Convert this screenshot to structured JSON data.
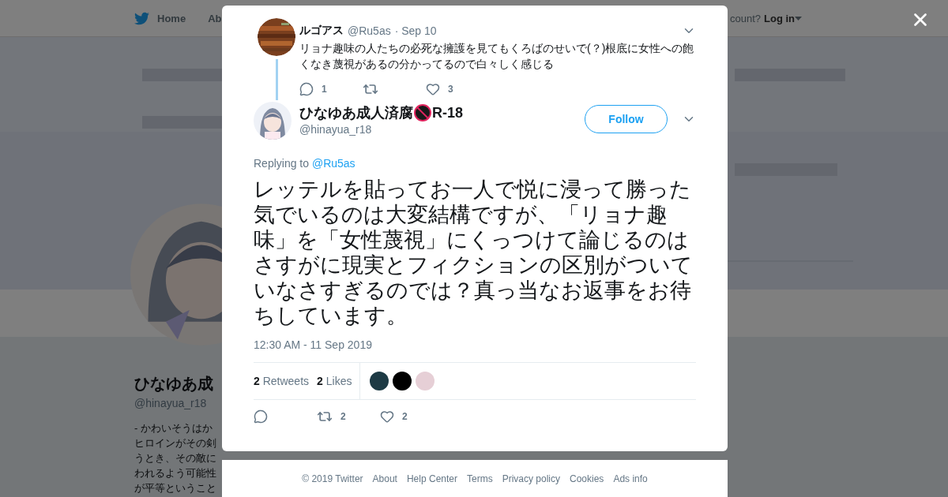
{
  "background_page": {
    "nav": {
      "items": [
        "Home",
        "Ab"
      ],
      "login_prompt": "count?",
      "login": "Log in"
    },
    "profile": {
      "name": "ひなゆあ成",
      "handle": "@hinayua_r18",
      "bio_lines": [
        "- かわいそうはか",
        "ヒロインがその剣",
        "うとき、その敵に",
        "われるよう可能性",
        "が平等ということ"
      ]
    }
  },
  "modal": {
    "parent_tweet": {
      "name": "ルゴアス",
      "handle": "@Ru5as",
      "date": "· Sep 10",
      "text": "リョナ趣味の人たちの必死な擁護を見てもくろばのせいで(？)根底に女性への飽くなき蔑視があるの分かってるので白々しく感じる",
      "replies": "1",
      "likes": "3"
    },
    "tweet": {
      "name": "ひなゆあ成人済腐",
      "name_suffix": "R-18",
      "handle": "@hinayua_r18",
      "follow": "Follow",
      "replying_label": "Replying to",
      "replying_to": "@Ru5as",
      "text": "レッテルを貼ってお一人で悦に浸って勝った気でいるのは大変結構ですが、「リョナ趣味」を「女性蔑視」にくっつけて論じるのはさすがに現実とフィクションの区別がついていなさすぎるのでは？真っ当なお返事をお待ちしています。",
      "timestamp": "12:30 AM - 11 Sep 2019",
      "retweets_count": "2",
      "retweets_label": "Retweets",
      "likes_count": "2",
      "likes_label": "Likes",
      "likers": [
        {
          "color": "#1d3a44"
        },
        {
          "color": "#000000"
        },
        {
          "color": "#e6cfd6"
        }
      ],
      "retweets": "2",
      "likes": "2"
    }
  },
  "footer": {
    "links": [
      "© 2019 Twitter",
      "About",
      "Help Center",
      "Terms",
      "Privacy policy",
      "Cookies",
      "Ads info"
    ]
  }
}
